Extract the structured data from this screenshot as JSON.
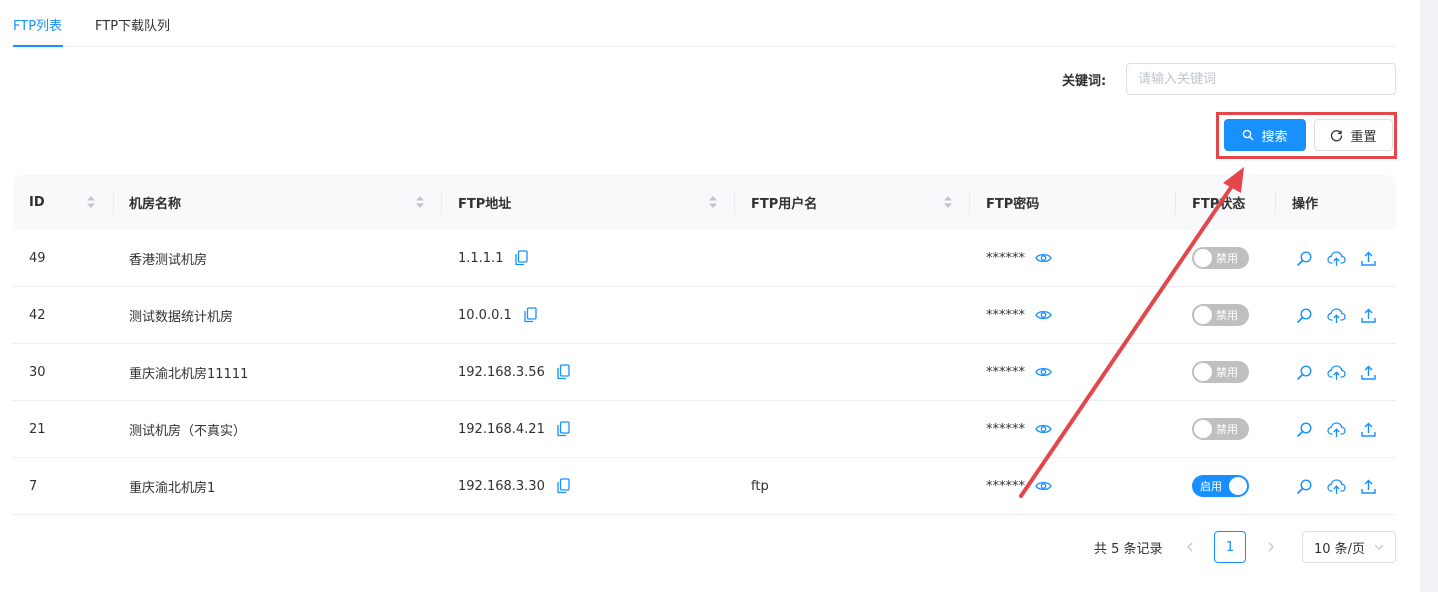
{
  "tabs": [
    {
      "label": "FTP列表",
      "active": true
    },
    {
      "label": "FTP下载队列",
      "active": false
    }
  ],
  "filter": {
    "keyword_label": "关键词:",
    "keyword_placeholder": "请输入关键词",
    "keyword_value": "",
    "search_label": "搜索",
    "reset_label": "重置"
  },
  "table": {
    "columns": [
      "ID",
      "机房名称",
      "FTP地址",
      "FTP用户名",
      "FTP密码",
      "FTP状态",
      "操作"
    ],
    "rows": [
      {
        "id": "49",
        "name": "香港测试机房",
        "address": "1.1.1.1",
        "username": "",
        "password": "******",
        "status": "禁用",
        "enabled": false
      },
      {
        "id": "42",
        "name": "测试数据统计机房",
        "address": "10.0.0.1",
        "username": "",
        "password": "******",
        "status": "禁用",
        "enabled": false
      },
      {
        "id": "30",
        "name": "重庆渝北机房11111",
        "address": "192.168.3.56",
        "username": "",
        "password": "******",
        "status": "禁用",
        "enabled": false
      },
      {
        "id": "21",
        "name": "测试机房（不真实）",
        "address": "192.168.4.21",
        "username": "",
        "password": "******",
        "status": "禁用",
        "enabled": false
      },
      {
        "id": "7",
        "name": "重庆渝北机房1",
        "address": "192.168.3.30",
        "username": "ftp",
        "password": "******",
        "status": "启用",
        "enabled": true
      }
    ]
  },
  "pagination": {
    "total_text": "共 5 条记录",
    "current_page": "1",
    "page_size": "10 条/页"
  },
  "colors": {
    "primary": "#1890ff",
    "annotation_red": "#e5464b",
    "switch_off": "#bfbfbf"
  },
  "icons": {
    "search_button": "search-icon",
    "reset_button": "refresh-icon",
    "sort": "sort-caret-icon",
    "copy": "copy-icon",
    "password": "eye-icon",
    "operations": [
      "magnify-icon",
      "cloud-upload-icon",
      "upload-icon"
    ]
  }
}
